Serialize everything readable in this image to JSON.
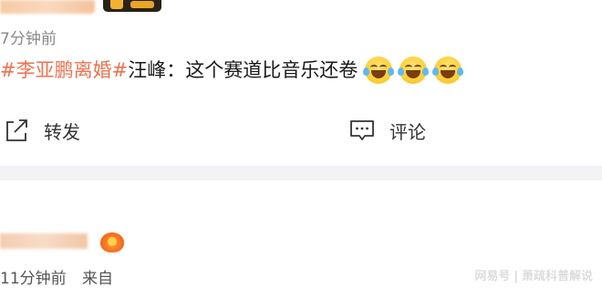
{
  "post": {
    "time": "7分钟前",
    "hashtag": "#李亚鹏离婚#",
    "text": "汪峰：这个赛道比音乐还卷",
    "emojis": [
      "laugh-cry-emoji",
      "laugh-cry-emoji",
      "laugh-cry-emoji"
    ]
  },
  "actions": {
    "share_label": "转发",
    "comment_label": "评论"
  },
  "reply": {
    "time": "11分钟前",
    "source": "来自"
  },
  "watermark": "网易号 | 萧疏科普解说",
  "colors": {
    "hashtag": "#eb7350",
    "divider": "#f3f3f5",
    "meta_text": "#8a8a8a"
  }
}
